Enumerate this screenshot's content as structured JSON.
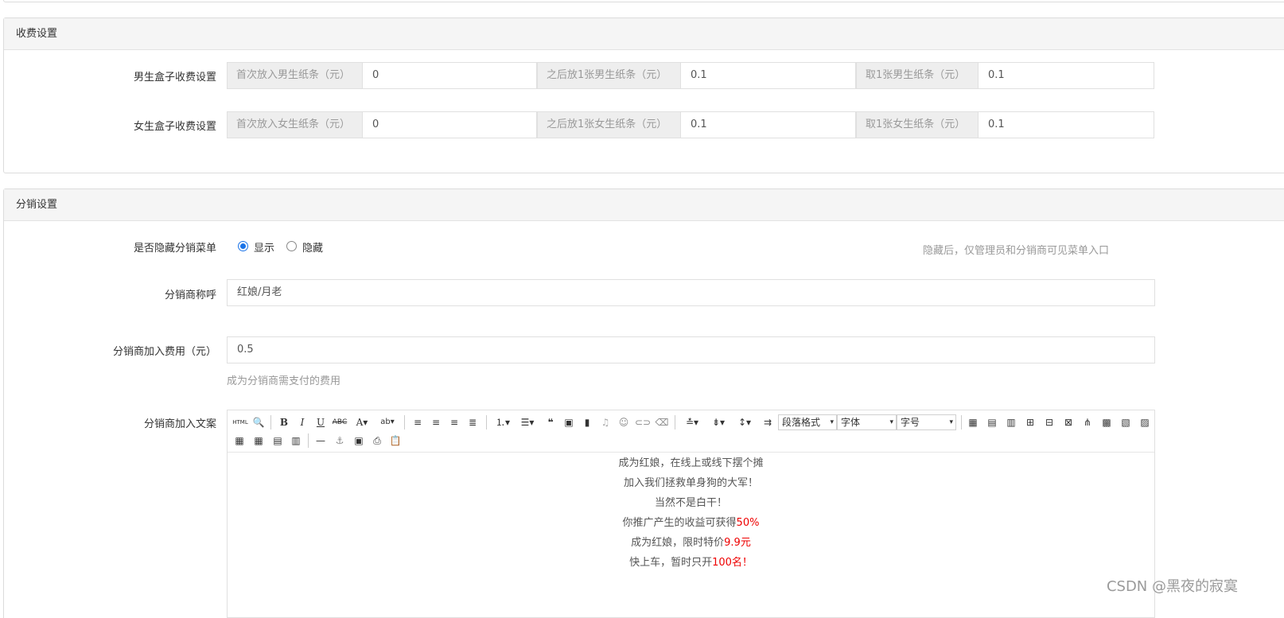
{
  "fee_panel": {
    "title": "收费设置",
    "rows": [
      {
        "label": "男生盒子收费设置",
        "fields": [
          {
            "addon": "首次放入男生纸条（元）",
            "value": "0"
          },
          {
            "addon": "之后放1张男生纸条（元）",
            "value": "0.1"
          },
          {
            "addon": "取1张男生纸条（元）",
            "value": "0.1"
          }
        ]
      },
      {
        "label": "女生盒子收费设置",
        "fields": [
          {
            "addon": "首次放入女生纸条（元）",
            "value": "0"
          },
          {
            "addon": "之后放1张女生纸条（元）",
            "value": "0.1"
          },
          {
            "addon": "取1张女生纸条（元）",
            "value": "0.1"
          }
        ]
      }
    ]
  },
  "dist_panel": {
    "title": "分销设置",
    "hide_menu": {
      "label": "是否隐藏分销菜单",
      "options": [
        {
          "label": "显示",
          "checked": true
        },
        {
          "label": "隐藏",
          "checked": false
        }
      ],
      "help": "隐藏后，仅管理员和分销商可见菜单入口"
    },
    "name": {
      "label": "分销商称呼",
      "value": "红娘/月老"
    },
    "fee": {
      "label": "分销商加入费用（元）",
      "value": "0.5",
      "help": "成为分销商需支付的费用"
    },
    "copy": {
      "label": "分销商加入文案",
      "toolbar": {
        "paragraph": "段落格式",
        "font": "字体",
        "size": "字号"
      },
      "lines": [
        {
          "text": "成为红娘，在线上或线下摆个摊",
          "highlight": ""
        },
        {
          "text": "加入我们拯救单身狗的大军！",
          "highlight": ""
        },
        {
          "text": "当然不是白干！",
          "highlight": ""
        },
        {
          "text": "你推广产生的收益可获得",
          "highlight": "50%"
        },
        {
          "text": "成为红娘，限时特价",
          "highlight": "9.9元"
        },
        {
          "text": "快上车，暂时只开",
          "highlight": "100名！"
        }
      ]
    }
  },
  "watermark": "CSDN @黑夜的寂寞",
  "colors": {
    "accent": "#1a73e8",
    "highlight": "#ee0000"
  }
}
